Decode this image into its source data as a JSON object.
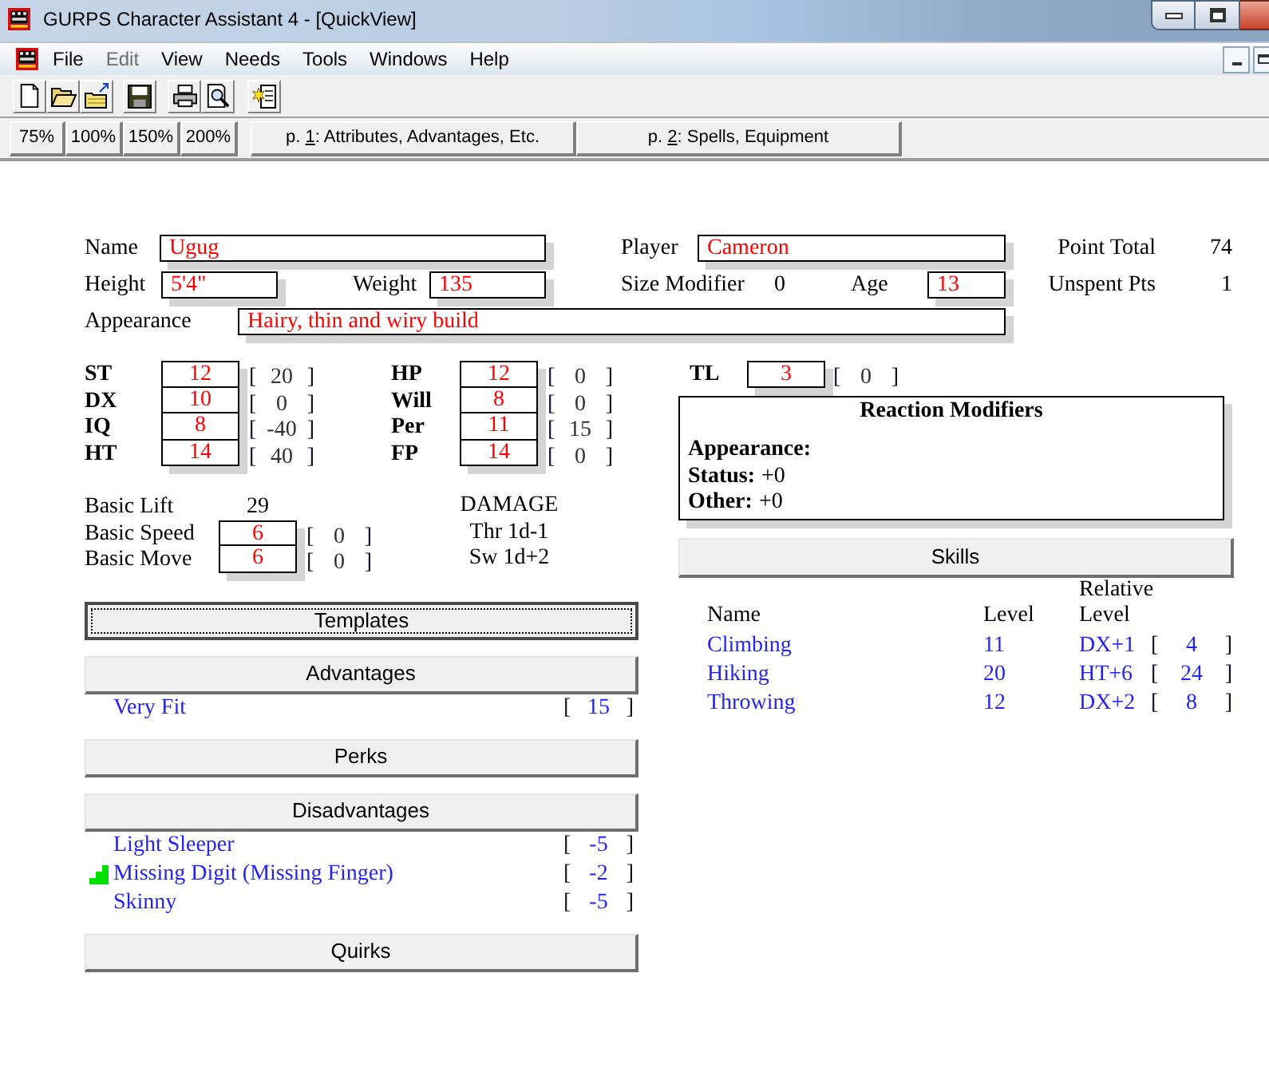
{
  "window": {
    "title": "GURPS Character Assistant 4 - [QuickView]"
  },
  "menu": [
    {
      "label": "File",
      "disabled": false
    },
    {
      "label": "Edit",
      "disabled": true
    },
    {
      "label": "View",
      "disabled": false
    },
    {
      "label": "Needs",
      "disabled": false
    },
    {
      "label": "Tools",
      "disabled": false
    },
    {
      "label": "Windows",
      "disabled": false
    },
    {
      "label": "Help",
      "disabled": false
    }
  ],
  "zoom_buttons": [
    "75%",
    "100%",
    "150%",
    "200%"
  ],
  "page_tabs": [
    {
      "prefix": "p. ",
      "accelerator": "1",
      "suffix": ": Attributes, Advantages, Etc."
    },
    {
      "prefix": "p. ",
      "accelerator": "2",
      "suffix": ": Spells, Equipment"
    }
  ],
  "character": {
    "name": {
      "label": "Name",
      "value": "Ugug"
    },
    "player": {
      "label": "Player",
      "value": "Cameron"
    },
    "point_total": {
      "label": "Point Total",
      "value": "74"
    },
    "height": {
      "label": "Height",
      "value": "5'4\""
    },
    "weight": {
      "label": "Weight",
      "value": "135"
    },
    "size_modifier": {
      "label": "Size Modifier",
      "value": "0"
    },
    "age": {
      "label": "Age",
      "value": "13"
    },
    "unspent_points": {
      "label": "Unspent Pts",
      "value": "1"
    },
    "appearance": {
      "label": "Appearance",
      "value": "Hairy, thin and wiry build"
    }
  },
  "attributes": [
    {
      "label": "ST",
      "value": "12",
      "points": [
        "[",
        "20",
        "]"
      ]
    },
    {
      "label": "DX",
      "value": "10",
      "points": [
        "[",
        "0",
        "]"
      ]
    },
    {
      "label": "IQ",
      "value": "8",
      "points": [
        "[",
        "-40",
        "]"
      ]
    },
    {
      "label": "HT",
      "value": "14",
      "points": [
        "[",
        "40",
        "]"
      ]
    }
  ],
  "secondary_attributes": [
    {
      "label": "HP",
      "value": "12",
      "points": [
        "[",
        "0",
        "]"
      ]
    },
    {
      "label": "Will",
      "value": "8",
      "points": [
        "[",
        "0",
        "]"
      ]
    },
    {
      "label": "Per",
      "value": "11",
      "points": [
        "[",
        "15",
        "]"
      ]
    },
    {
      "label": "FP",
      "value": "14",
      "points": [
        "[",
        "0",
        "]"
      ]
    }
  ],
  "tech_level": {
    "label": "TL",
    "value": "3",
    "points": [
      "[",
      "0",
      "]"
    ]
  },
  "reaction_modifiers": {
    "title": "Reaction Modifiers",
    "lines": [
      {
        "label": "Appearance:"
      },
      {
        "label": "Status:",
        "value": "+0"
      },
      {
        "label": "Other:",
        "value": "+0"
      }
    ]
  },
  "derived": [
    {
      "kind": "plain",
      "label": "Basic Lift",
      "value": "29"
    },
    {
      "kind": "field",
      "label": "Basic Speed",
      "value": "6",
      "points": [
        "[",
        "0",
        "]"
      ]
    },
    {
      "kind": "field",
      "label": "Basic Move",
      "value": "6",
      "points": [
        "[",
        "0",
        "]"
      ]
    }
  ],
  "damage": {
    "title": "DAMAGE",
    "lines": [
      "Thr 1d-1",
      "Sw 1d+2"
    ]
  },
  "sections": [
    {
      "title": "Templates",
      "focused": true
    },
    {
      "title": "Advantages",
      "focused": false,
      "items": [
        {
          "name": "Very Fit",
          "points": [
            "[",
            "15",
            "]"
          ],
          "marked": false
        }
      ]
    },
    {
      "title": "Perks",
      "focused": false
    },
    {
      "title": "Disadvantages",
      "focused": false,
      "items": [
        {
          "name": "Light Sleeper",
          "points": [
            "[",
            "-5",
            "]"
          ],
          "marked": false
        },
        {
          "name": "Missing Digit (Missing Finger)",
          "points": [
            "[",
            "-2",
            "]"
          ],
          "marked": true
        },
        {
          "name": "Skinny",
          "points": [
            "[",
            "-5",
            "]"
          ],
          "marked": false
        }
      ]
    },
    {
      "title": "Quirks",
      "focused": false
    }
  ],
  "skills": {
    "title": "Skills",
    "columns": [
      "Name",
      "Level",
      "Relative Level"
    ],
    "rows": [
      {
        "name": "Climbing",
        "level": "11",
        "relative_level": "DX+1",
        "points": [
          "[",
          "4",
          "]"
        ]
      },
      {
        "name": "Hiking",
        "level": "20",
        "relative_level": "HT+6",
        "points": [
          "[",
          "24",
          "]"
        ]
      },
      {
        "name": "Throwing",
        "level": "12",
        "relative_level": "DX+2",
        "points": [
          "[",
          "8",
          "]"
        ]
      }
    ]
  }
}
